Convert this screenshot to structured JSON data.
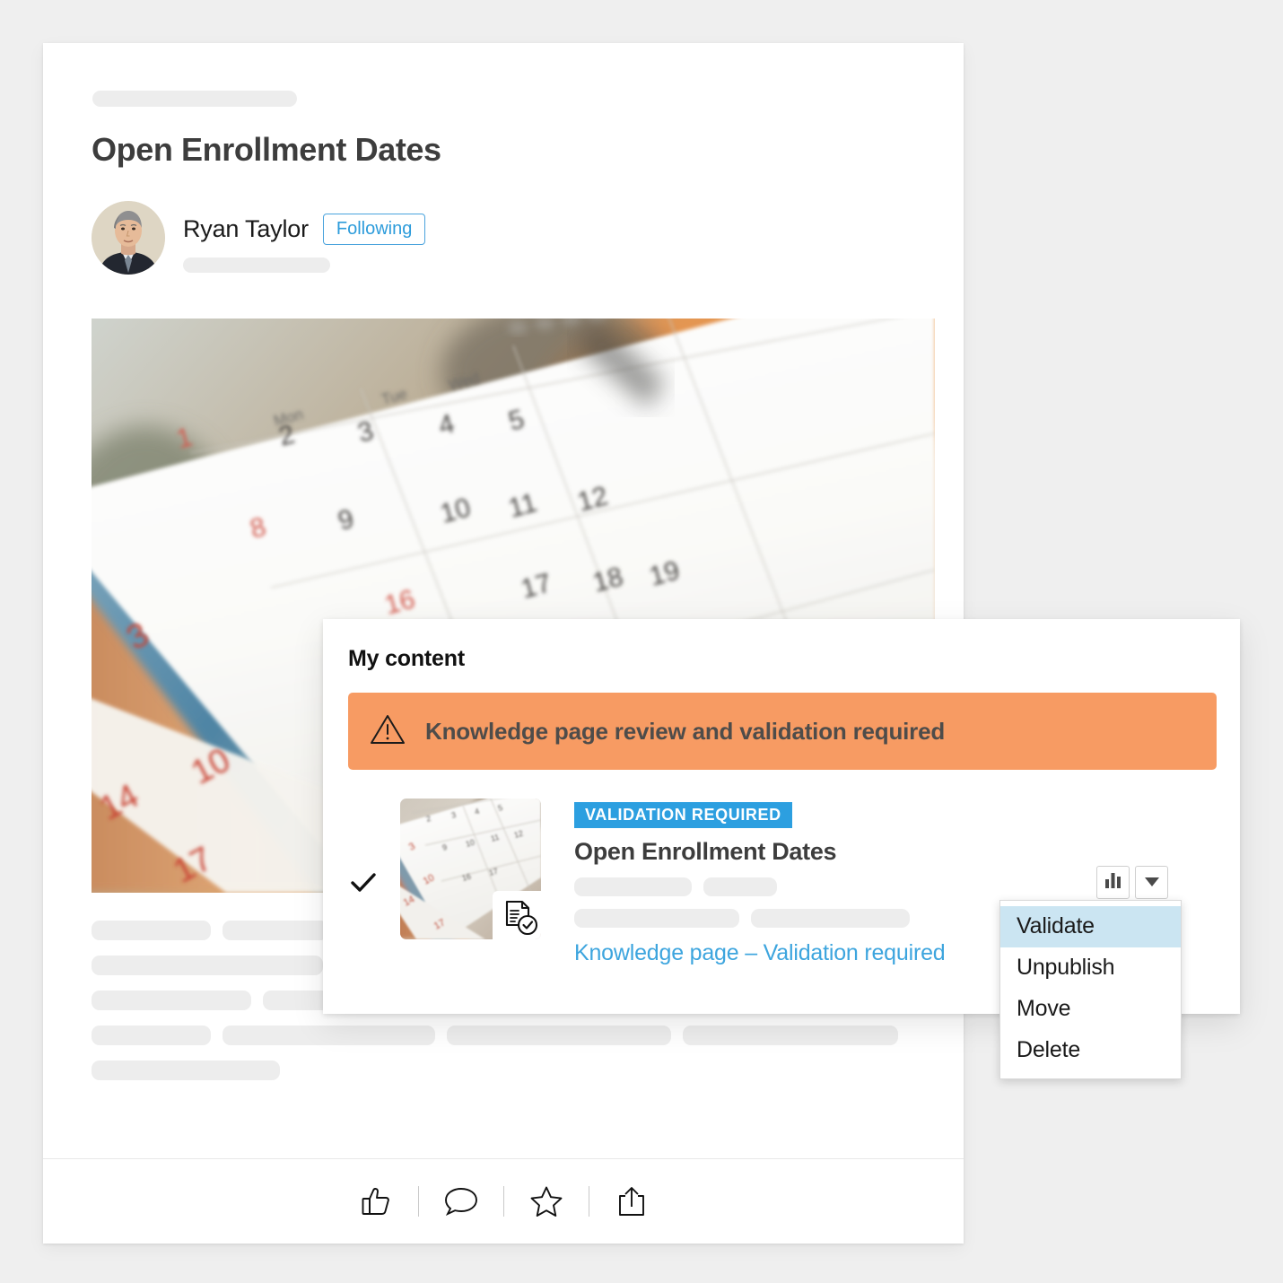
{
  "page": {
    "background_color": "#efefef"
  },
  "article": {
    "title": "Open Enrollment Dates",
    "author": {
      "name": "Ryan Taylor",
      "follow_state_label": "Following",
      "follow_badge_color": "#2d9cdb"
    },
    "hero_image_alt": "Blurred desk calendar pages",
    "footer_actions": [
      {
        "name": "like",
        "icon": "thumbs-up-icon"
      },
      {
        "name": "comment",
        "icon": "comment-bubble-icon"
      },
      {
        "name": "favorite",
        "icon": "star-icon"
      },
      {
        "name": "share",
        "icon": "share-icon"
      }
    ]
  },
  "my_content_panel": {
    "title": "My content",
    "alert": {
      "text": "Knowledge page review and validation required",
      "background_color": "#f79b63",
      "icon": "warning-triangle-icon"
    },
    "item": {
      "checked": true,
      "status_badge": "VALIDATION  REQUIRED",
      "status_badge_color": "#2c9fe0",
      "title": "Open Enrollment Dates",
      "link_text": "Knowledge page – Validation required",
      "link_color": "#3da5de",
      "thumbnail_alt": "Calendar pages thumbnail",
      "thumbnail_badge_icon": "document-check-icon",
      "buttons": [
        {
          "name": "analytics",
          "icon": "bar-chart-icon"
        },
        {
          "name": "more-actions",
          "icon": "chevron-down-icon"
        }
      ]
    }
  },
  "dropdown_menu": {
    "items": [
      {
        "label": "Validate",
        "selected": true
      },
      {
        "label": "Unpublish",
        "selected": false
      },
      {
        "label": "Move",
        "selected": false
      },
      {
        "label": "Delete",
        "selected": false
      }
    ],
    "highlight_color": "#cbe5f2"
  }
}
